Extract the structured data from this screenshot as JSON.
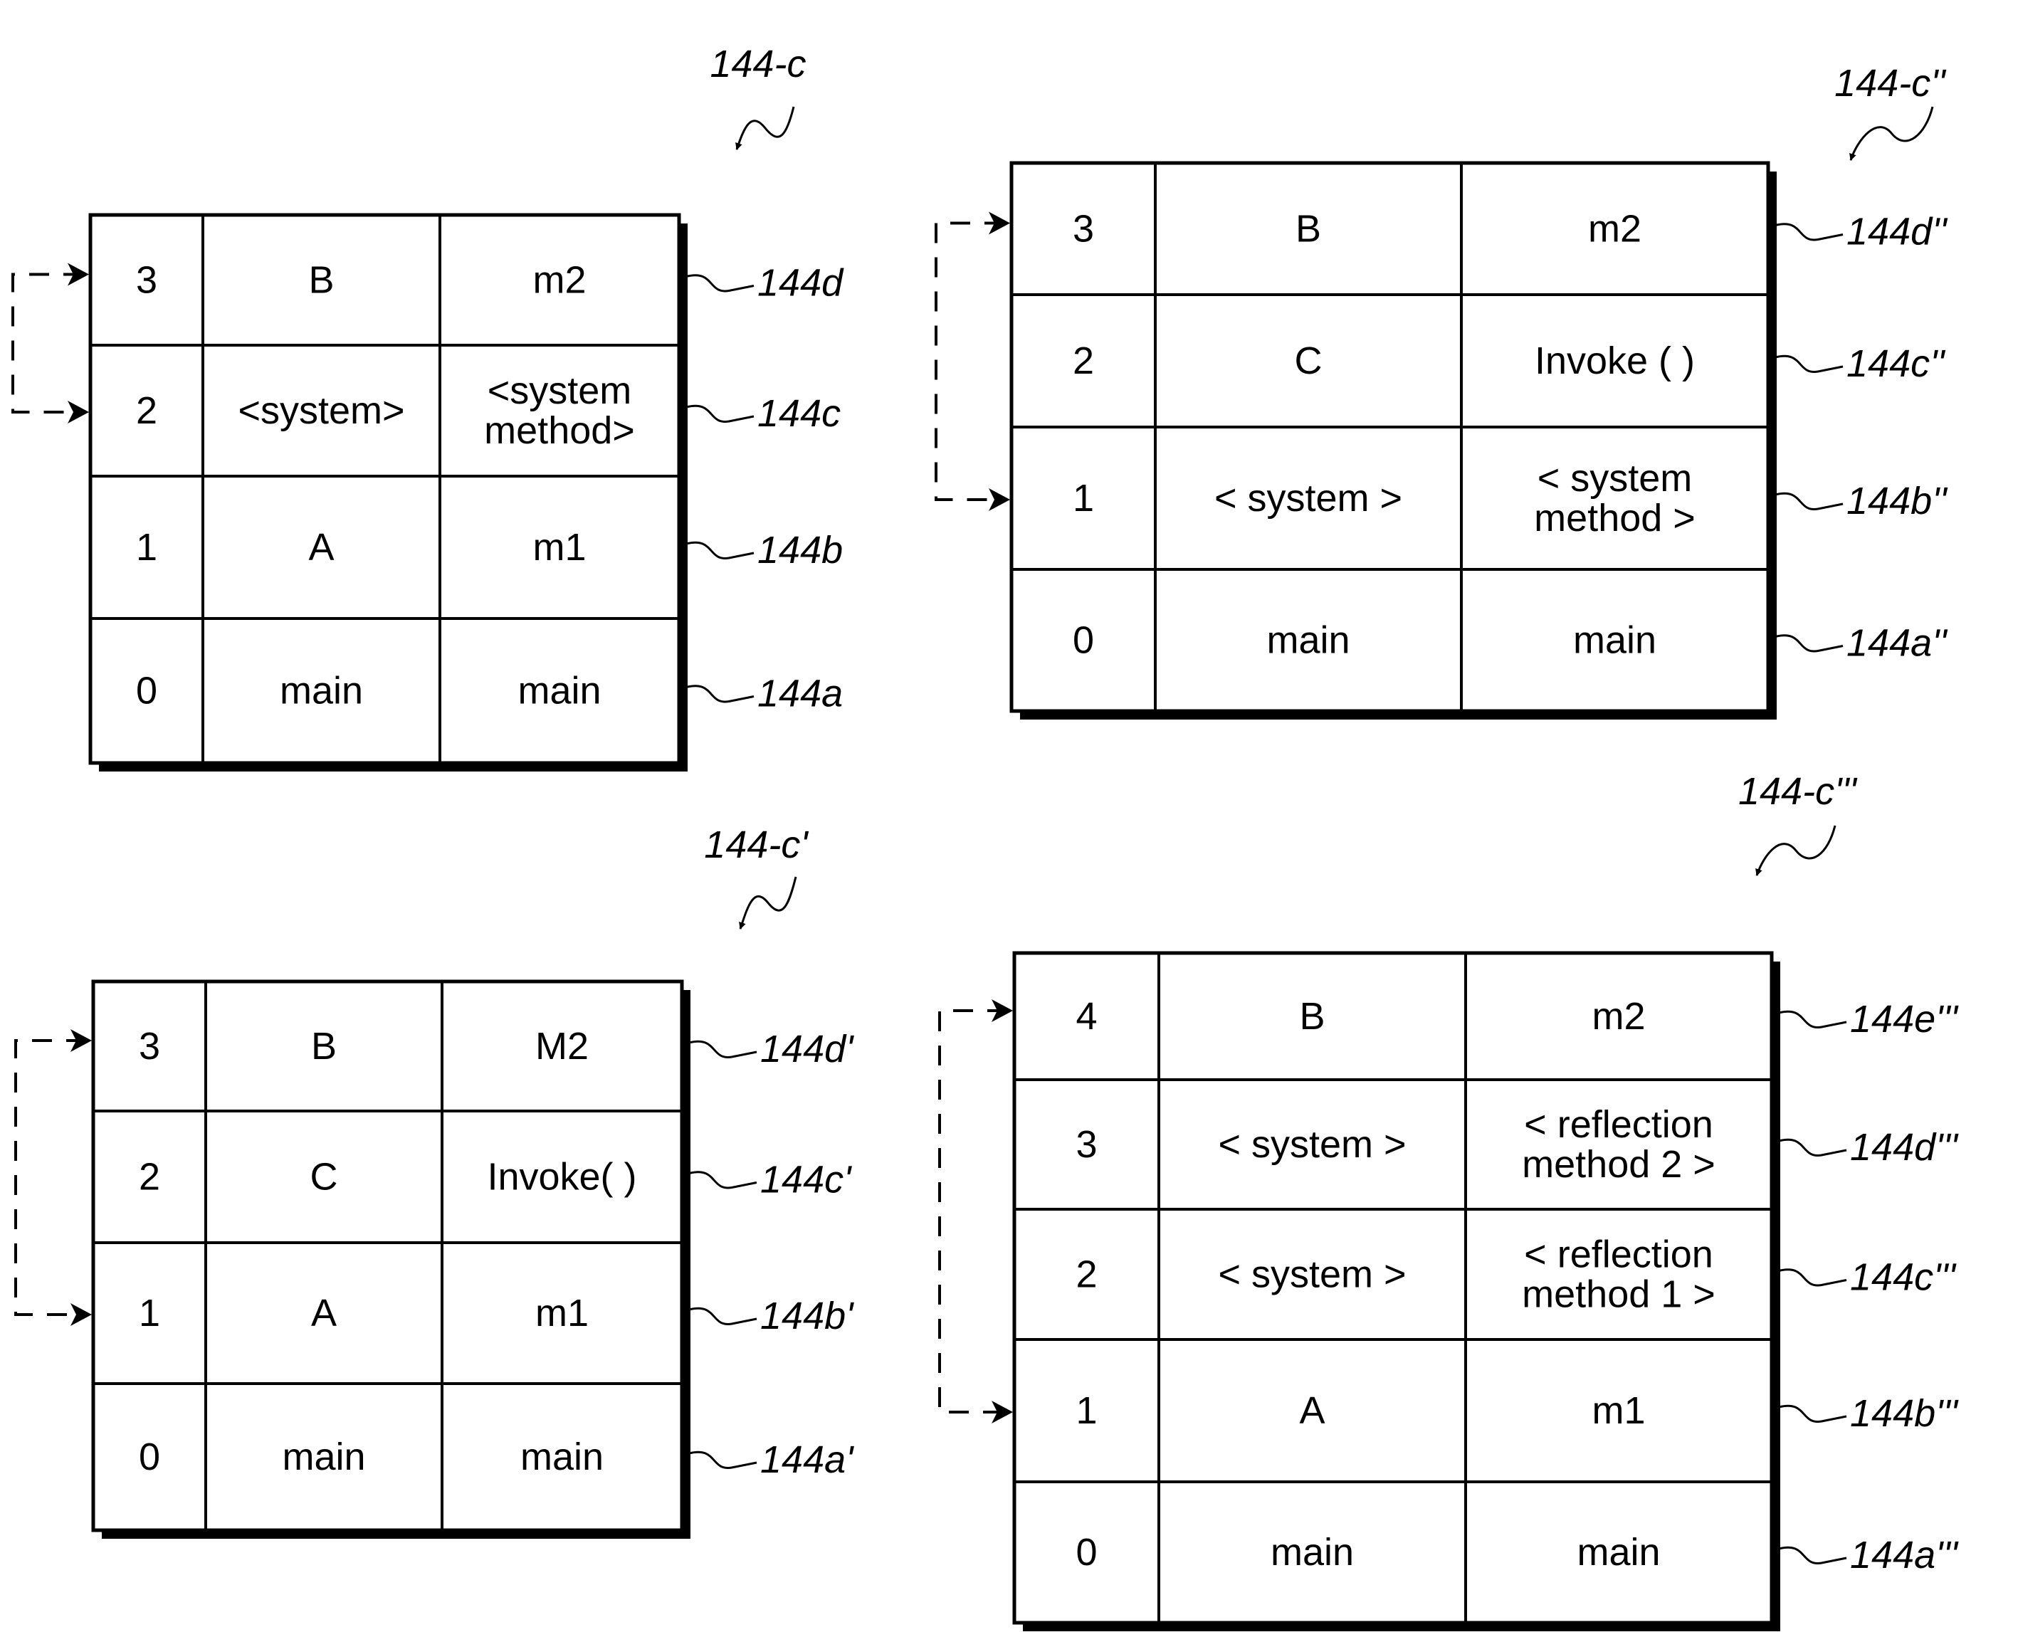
{
  "figures": [
    {
      "id": "144-c",
      "label": "144-c",
      "rows": [
        {
          "index": "3",
          "class": "B",
          "method": [
            "m2"
          ],
          "ref": "144d"
        },
        {
          "index": "2",
          "class": "<system>",
          "method": [
            "<system",
            "  method>"
          ],
          "ref": "144c"
        },
        {
          "index": "1",
          "class": "A",
          "method": [
            "m1"
          ],
          "ref": "144b"
        },
        {
          "index": "0",
          "class": "main",
          "method": [
            "main"
          ],
          "ref": "144a"
        }
      ],
      "arrow_between_indices": [
        "3",
        "2"
      ]
    },
    {
      "id": "144-c-double-prime",
      "label": "144-c''",
      "rows": [
        {
          "index": "3",
          "class": "B",
          "method": [
            "m2"
          ],
          "ref": "144d''"
        },
        {
          "index": "2",
          "class": "C",
          "method": [
            "Invoke ( )"
          ],
          "ref": "144c''"
        },
        {
          "index": "1",
          "class": "< system >",
          "method": [
            "< system",
            "  method >"
          ],
          "ref": "144b''"
        },
        {
          "index": "0",
          "class": "main",
          "method": [
            "main"
          ],
          "ref": "144a''"
        }
      ],
      "arrow_between_indices": [
        "3",
        "1"
      ]
    },
    {
      "id": "144-c-prime",
      "label": "144-c'",
      "rows": [
        {
          "index": "3",
          "class": "B",
          "method": [
            "M2"
          ],
          "ref": "144d'"
        },
        {
          "index": "2",
          "class": "C",
          "method": [
            "Invoke( )"
          ],
          "ref": "144c'"
        },
        {
          "index": "1",
          "class": "A",
          "method": [
            "m1"
          ],
          "ref": "144b'"
        },
        {
          "index": "0",
          "class": "main",
          "method": [
            "main"
          ],
          "ref": "144a'"
        }
      ],
      "arrow_between_indices": [
        "3",
        "1"
      ]
    },
    {
      "id": "144-c-triple-prime",
      "label": "144-c'''",
      "rows": [
        {
          "index": "4",
          "class": "B",
          "method": [
            "m2"
          ],
          "ref": "144e'''"
        },
        {
          "index": "3",
          "class": "< system >",
          "method": [
            "< reflection",
            "  method 2 >"
          ],
          "ref": "144d'''"
        },
        {
          "index": "2",
          "class": "< system >",
          "method": [
            "< reflection",
            "  method 1 >"
          ],
          "ref": "144c'''"
        },
        {
          "index": "1",
          "class": "A",
          "method": [
            "m1"
          ],
          "ref": "144b'''"
        },
        {
          "index": "0",
          "class": "main",
          "method": [
            "main"
          ],
          "ref": "144a'''"
        }
      ],
      "arrow_between_indices": [
        "4",
        "1"
      ]
    }
  ]
}
